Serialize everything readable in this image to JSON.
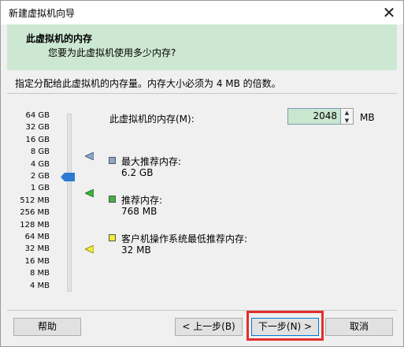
{
  "window": {
    "title": "新建虚拟机向导",
    "close_label": "✕"
  },
  "header": {
    "title": "此虚拟机的内存",
    "subtitle": "您要为此虚拟机使用多少内存?"
  },
  "instruction": "指定分配给此虚拟机的内存量。内存大小必须为 4 MB 的倍数。",
  "scale": {
    "labels": [
      "64 GB",
      "32 GB",
      "16 GB",
      "8 GB",
      "4 GB",
      "2 GB",
      "1 GB",
      "512 MB",
      "256 MB",
      "128 MB",
      "64 MB",
      "32 MB",
      "16 MB",
      "8 MB",
      "4 MB"
    ],
    "current_level": "2 GB"
  },
  "memory": {
    "label": "此虚拟机的内存(M):",
    "value": "2048",
    "unit": "MB"
  },
  "recommendations": {
    "max": {
      "label": "最大推荐内存:",
      "value": "6.2 GB",
      "color": "#8fa6c8"
    },
    "recommended": {
      "label": "推荐内存:",
      "value": "768 MB",
      "color": "#3fb23f"
    },
    "min": {
      "label": "客户机操作系统最低推荐内存:",
      "value": "32 MB",
      "color": "#f0ee3a"
    }
  },
  "buttons": {
    "help": "帮助",
    "back": "< 上一步(B)",
    "next": "下一步(N) >",
    "cancel": "取消"
  },
  "colors": {
    "header_bg": "#cde8d2",
    "input_bg": "#c9e6cf",
    "highlight": "#e0302b",
    "thumb": "#2e7ad1"
  }
}
